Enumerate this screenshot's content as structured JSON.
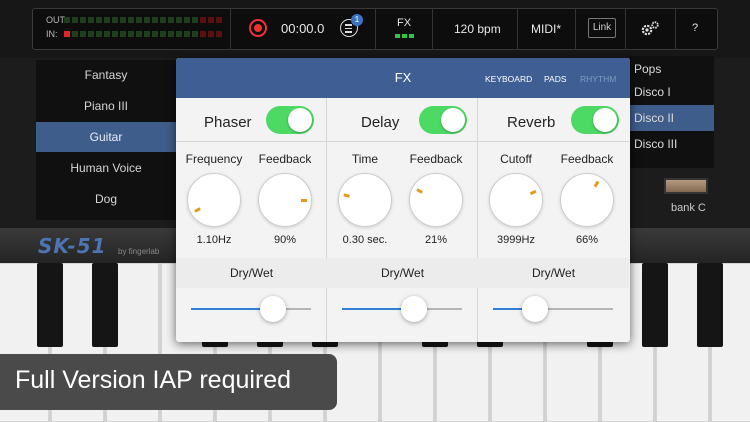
{
  "toolbar": {
    "out_label": "OUT:",
    "in_label": "IN:",
    "time": "00:00.0",
    "badge_count": "1",
    "fx_label": "FX",
    "bpm": "120 bpm",
    "midi": "MIDI*",
    "link": "Link",
    "help": "?"
  },
  "presets": [
    "Fantasy",
    "Piano III",
    "Guitar",
    "Human Voice",
    "Dog"
  ],
  "selected_preset": "Guitar",
  "banks": [
    "Pops",
    "Disco I",
    "Disco II",
    "Disco III"
  ],
  "selected_bank": "Disco II",
  "bank_label": "bank C",
  "logo": {
    "name": "SK-51",
    "by": "by fingerlab"
  },
  "fx_panel": {
    "title": "FX",
    "tabs": [
      {
        "label": "KEYBOARD",
        "active": true
      },
      {
        "label": "PADS",
        "active": true
      },
      {
        "label": "RHYTHM",
        "active": false
      }
    ],
    "toggle_color": "#4cd964",
    "accent_color": "#2f7ed8",
    "effects": [
      {
        "name": "Phaser",
        "enabled": true,
        "params": [
          {
            "label": "Frequency",
            "value": "1.10Hz",
            "knob_angle": 150
          },
          {
            "label": "Feedback",
            "value": "90%",
            "knob_angle": 0
          }
        ],
        "drywet_label": "Dry/Wet",
        "drywet": 0.68
      },
      {
        "name": "Delay",
        "enabled": true,
        "params": [
          {
            "label": "Time",
            "value": "0.30 sec.",
            "knob_angle": 195
          },
          {
            "label": "Feedback",
            "value": "21%",
            "knob_angle": 210
          }
        ],
        "drywet_label": "Dry/Wet",
        "drywet": 0.6
      },
      {
        "name": "Reverb",
        "enabled": true,
        "params": [
          {
            "label": "Cutoff",
            "value": "3999Hz",
            "knob_angle": -25
          },
          {
            "label": "Feedback",
            "value": "66%",
            "knob_angle": -60
          }
        ],
        "drywet_label": "Dry/Wet",
        "drywet": 0.35
      }
    ]
  },
  "banner": {
    "text": "Full Version IAP required"
  }
}
